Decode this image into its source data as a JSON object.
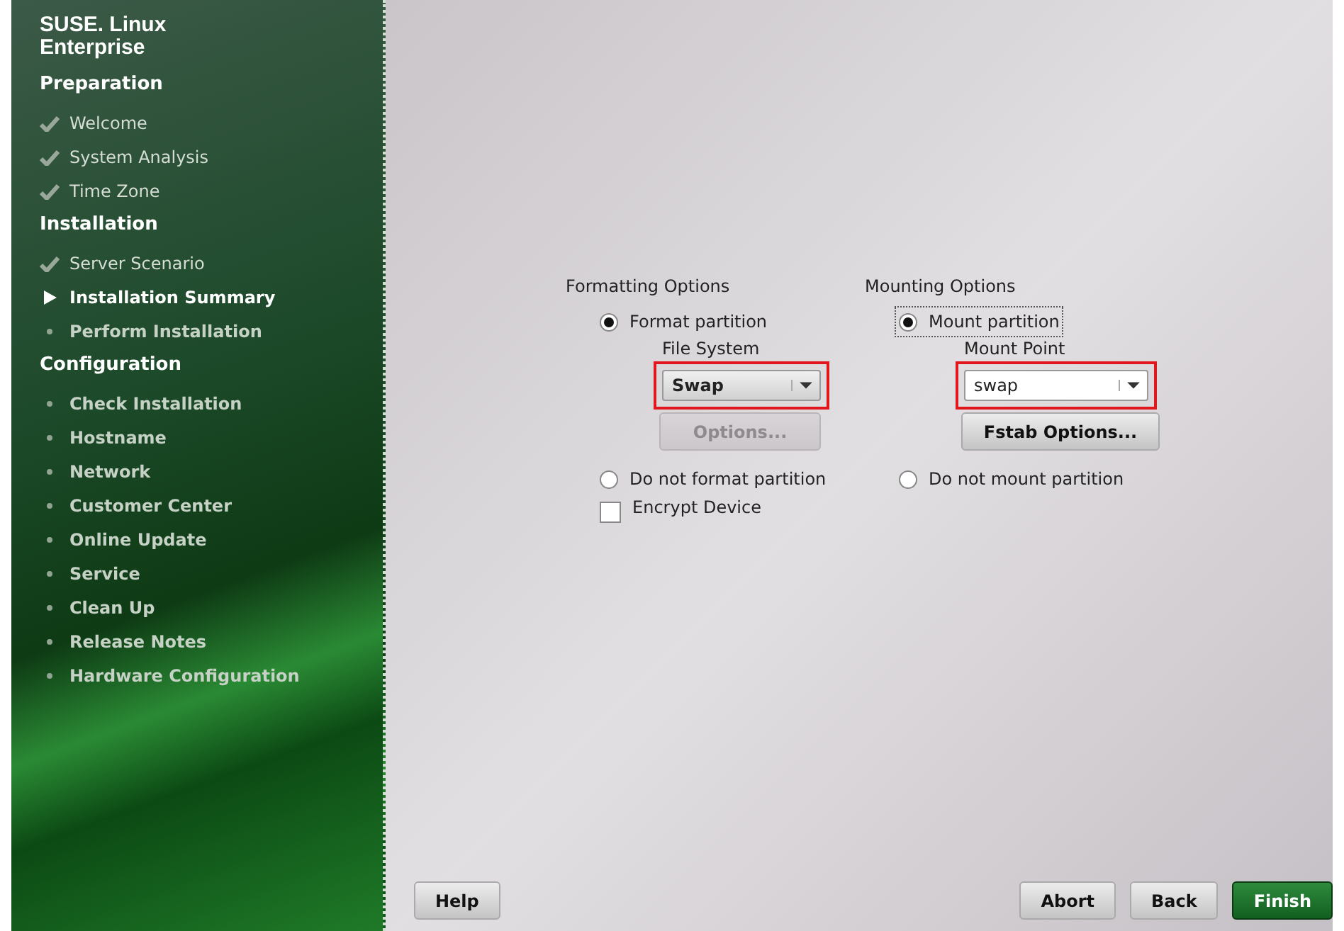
{
  "sidebar": {
    "logo": [
      "SUSE. Linux",
      "Enterprise"
    ],
    "sections": [
      {
        "title": "Preparation",
        "steps": [
          {
            "label": "Welcome",
            "done": true,
            "current": false
          },
          {
            "label": "System Analysis",
            "done": true,
            "current": false
          },
          {
            "label": "Time Zone",
            "done": true,
            "current": false
          }
        ]
      },
      {
        "title": "Installation",
        "steps": [
          {
            "label": "Server Scenario",
            "done": true,
            "current": false
          },
          {
            "label": "Installation Summary",
            "done": false,
            "current": true
          },
          {
            "label": "Perform Installation",
            "done": false,
            "current": false
          }
        ]
      },
      {
        "title": "Configuration",
        "steps": [
          {
            "label": "Check Installation",
            "done": false,
            "current": false
          },
          {
            "label": "Hostname",
            "done": false,
            "current": false
          },
          {
            "label": "Network",
            "done": false,
            "current": false
          },
          {
            "label": "Customer Center",
            "done": false,
            "current": false
          },
          {
            "label": "Online Update",
            "done": false,
            "current": false
          },
          {
            "label": "Service",
            "done": false,
            "current": false
          },
          {
            "label": "Clean Up",
            "done": false,
            "current": false
          },
          {
            "label": "Release Notes",
            "done": false,
            "current": false
          },
          {
            "label": "Hardware Configuration",
            "done": false,
            "current": false
          }
        ]
      }
    ]
  },
  "formatting": {
    "title": "Formatting Options",
    "format": {
      "label": "Format partition",
      "selected": true
    },
    "file_system": {
      "label": "File System",
      "value": "Swap",
      "highlighted": true
    },
    "options_button": {
      "label": "Options...",
      "disabled": true
    },
    "no_format": {
      "label": "Do not format partition",
      "selected": false
    },
    "encrypt": {
      "label": "Encrypt Device",
      "checked": false
    }
  },
  "mounting": {
    "title": "Mounting Options",
    "mount": {
      "label": "Mount partition",
      "selected": true
    },
    "mount_point": {
      "label": "Mount Point",
      "value": "swap",
      "highlighted": true
    },
    "fstab_button": {
      "label": "Fstab Options...",
      "disabled": false
    },
    "no_mount": {
      "label": "Do not mount partition",
      "selected": false
    }
  },
  "buttons": [
    {
      "label": "Help",
      "kind": "left"
    },
    {
      "label": "Abort",
      "kind": "plain"
    },
    {
      "label": "Back",
      "kind": "plain"
    },
    {
      "label": "Finish",
      "kind": "primary"
    }
  ]
}
